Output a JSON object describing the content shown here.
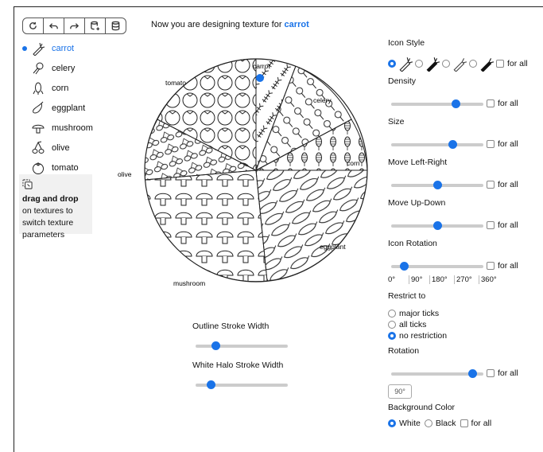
{
  "header": {
    "prefix": "Now you are designing texture for ",
    "current": "carrot"
  },
  "textures": [
    {
      "label": "carrot",
      "icon": "carrot-icon",
      "active": true
    },
    {
      "label": "celery",
      "icon": "celery-icon",
      "active": false
    },
    {
      "label": "corn",
      "icon": "corn-icon",
      "active": false
    },
    {
      "label": "eggplant",
      "icon": "eggplant-icon",
      "active": false
    },
    {
      "label": "mushroom",
      "icon": "mushroom-icon",
      "active": false
    },
    {
      "label": "olive",
      "icon": "olive-icon",
      "active": false
    },
    {
      "label": "tomato",
      "icon": "tomato-icon",
      "active": false
    }
  ],
  "hint": {
    "bold": "drag and drop",
    "rest": " on textures to switch texture parameters"
  },
  "pie_labels": {
    "carrot": "carrot",
    "celery": "celery",
    "corn": "corn",
    "eggplant": "eggplant",
    "mushroom": "mushroom",
    "olive": "olive",
    "tomato": "tomato"
  },
  "left_controls": {
    "outline_label": "Outline Stroke Width",
    "outline_value": 0.22,
    "halo_label": "White Halo Stroke Width",
    "halo_value": 0.17
  },
  "panel": {
    "icon_style": "Icon Style",
    "for_all": "for all",
    "density": "Density",
    "density_value": 0.7,
    "size": "Size",
    "size_value": 0.67,
    "move_lr": "Move Left-Right",
    "move_lr_value": 0.5,
    "move_ud": "Move Up-Down",
    "move_ud_value": 0.5,
    "icon_rotation": "Icon Rotation",
    "icon_rotation_value": 0.14,
    "rotation_ticks": [
      "0°",
      "90°",
      "180°",
      "270°",
      "360°"
    ],
    "restrict_to": "Restrict to",
    "restrict_options": [
      "major ticks",
      "all ticks",
      "no restriction"
    ],
    "restrict_selected": 2,
    "rotation": "Rotation",
    "rotation_value": 0.88,
    "rotation_input": "90°",
    "background_color": "Background Color",
    "bg_white": "White",
    "bg_black": "Black",
    "accent": "#1a73e8"
  }
}
